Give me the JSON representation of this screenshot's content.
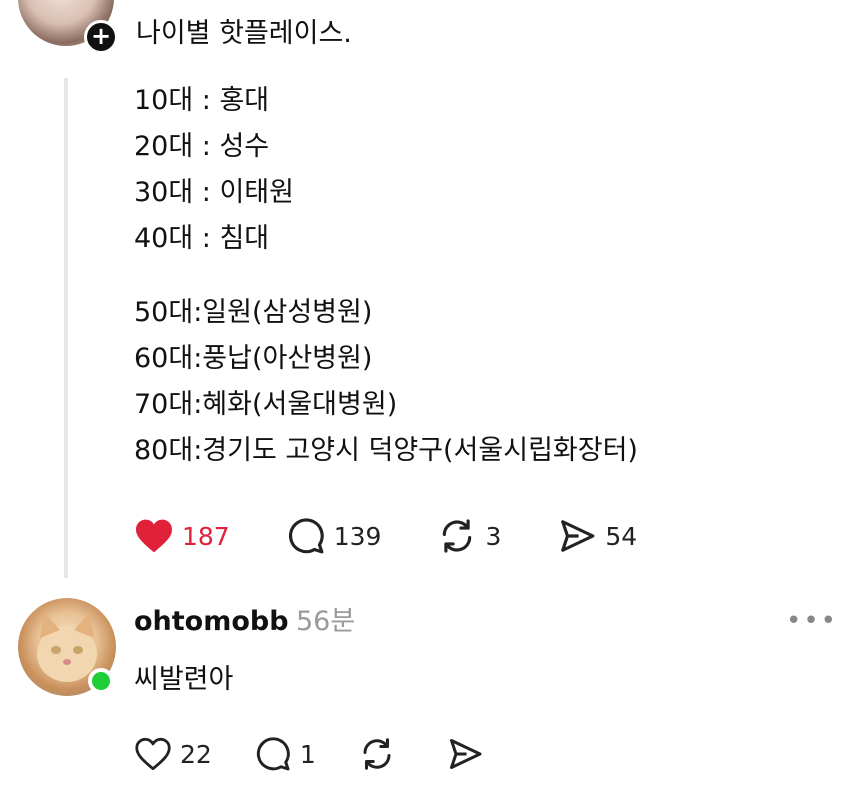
{
  "post": {
    "title": "나이별 핫플레이스.",
    "lines_group1": [
      "10대 : 홍대",
      "20대 : 성수",
      "30대 : 이태원",
      "40대 : 침대"
    ],
    "lines_group2": [
      "50대:일원(삼성병원)",
      "60대:풍납(아산병원)",
      "70대:혜화(서울대병원)",
      "80대:경기도 고양시 덕양구(서울시립화장터)"
    ],
    "stats": {
      "likes": "187",
      "comments": "139",
      "reposts": "3",
      "shares": "54"
    }
  },
  "comment": {
    "username": "ohtomobb",
    "time": "56분",
    "text": "씨발련아",
    "more": "•••",
    "stats": {
      "likes": "22",
      "comments": "1"
    }
  },
  "colors": {
    "like_active": "#e0213a",
    "online": "#1fce37",
    "muted": "#9a9a9a"
  },
  "icons": [
    "plus-icon",
    "heart-icon",
    "comment-icon",
    "repost-icon",
    "share-icon",
    "more-icon"
  ]
}
